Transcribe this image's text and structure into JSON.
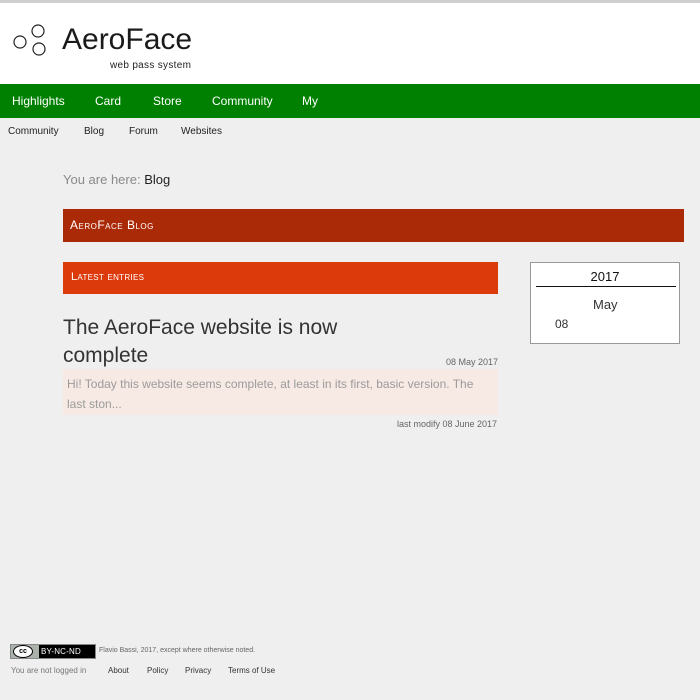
{
  "header": {
    "title": "AeroFace",
    "subtitle": "web pass system"
  },
  "main_nav": {
    "items": [
      "Highlights",
      "Card",
      "Store",
      "Community",
      "My"
    ]
  },
  "sub_nav": {
    "items": [
      "Community",
      "Blog",
      "Forum",
      "Websites"
    ]
  },
  "breadcrumb": {
    "prefix": "You are here: ",
    "current": "Blog"
  },
  "blog": {
    "title": "AeroFace Blog",
    "section_title": "Latest entries",
    "post": {
      "title": "The AeroFace website is now complete",
      "date": "08 May 2017",
      "excerpt": "Hi! Today this website seems complete, at least in its first, basic version. The last ston...",
      "modified": "last modify 08 June 2017"
    }
  },
  "calendar": {
    "year": "2017",
    "month": "May",
    "day": "08"
  },
  "footer": {
    "license_badge": "BY-NC-ND",
    "license_cc": "cc",
    "copyright": "Flavio Bassi, 2017, except where otherwise noted.",
    "login_status": "You are not logged in",
    "links": [
      "About",
      "Policy",
      "Privacy",
      "Terms of Use"
    ]
  },
  "colors": {
    "nav_green": "#008000",
    "blog_bar": "#aa2a08",
    "latest_bar": "#dd3a0c",
    "excerpt_bg": "#f7e9e3",
    "page_bg": "#efefef"
  }
}
